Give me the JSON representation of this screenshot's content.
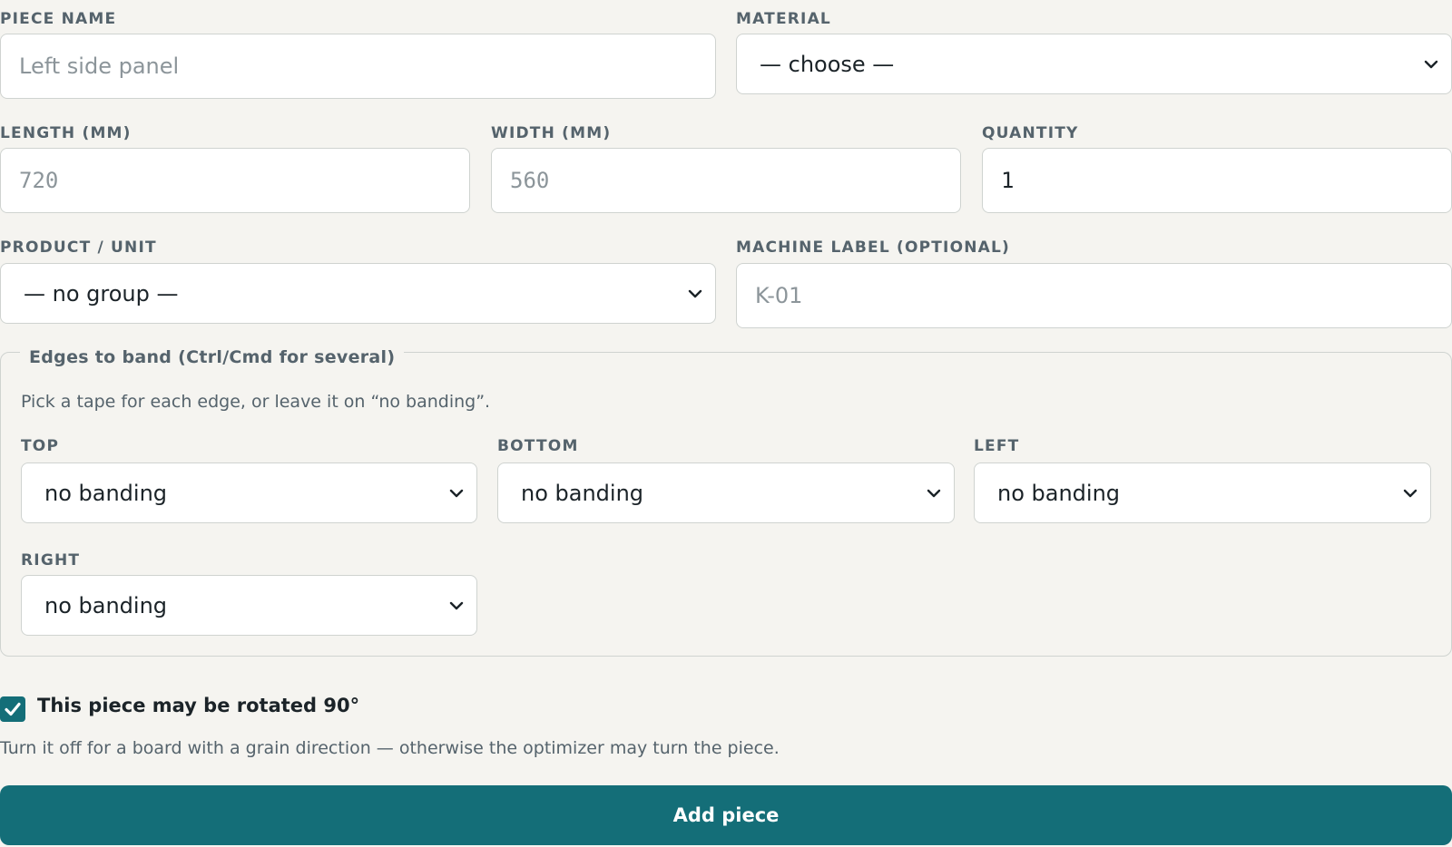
{
  "form": {
    "piece_name": {
      "label": "PIECE NAME",
      "placeholder": "Left side panel"
    },
    "material": {
      "label": "MATERIAL",
      "selected": "— choose —"
    },
    "length": {
      "label": "LENGTH (MM)",
      "placeholder": "720"
    },
    "width": {
      "label": "WIDTH (MM)",
      "placeholder": "560"
    },
    "quantity": {
      "label": "QUANTITY",
      "value": "1"
    },
    "product_unit": {
      "label": "PRODUCT / UNIT",
      "selected": "— no group —"
    },
    "machine_label": {
      "label": "MACHINE LABEL (OPTIONAL)",
      "placeholder": "K-01"
    }
  },
  "edges": {
    "legend": "Edges to band (Ctrl/Cmd for several)",
    "hint": "Pick a tape for each edge, or leave it on “no banding”.",
    "top": {
      "label": "TOP",
      "selected": "no banding"
    },
    "bottom": {
      "label": "BOTTOM",
      "selected": "no banding"
    },
    "left": {
      "label": "LEFT",
      "selected": "no banding"
    },
    "right": {
      "label": "RIGHT",
      "selected": "no banding"
    }
  },
  "rotate": {
    "checked": true,
    "label": "This piece may be rotated 90°",
    "hint": "Turn it off for a board with a grain direction — otherwise the optimizer may turn the piece."
  },
  "submit_label": "Add piece",
  "colors": {
    "accent": "#146e78",
    "background": "#f5f4f0",
    "border": "#cfd3d0",
    "label": "#55636c"
  },
  "icons": {
    "select_arrow": "chevron-down-icon",
    "checkbox": "checkmark-icon"
  }
}
